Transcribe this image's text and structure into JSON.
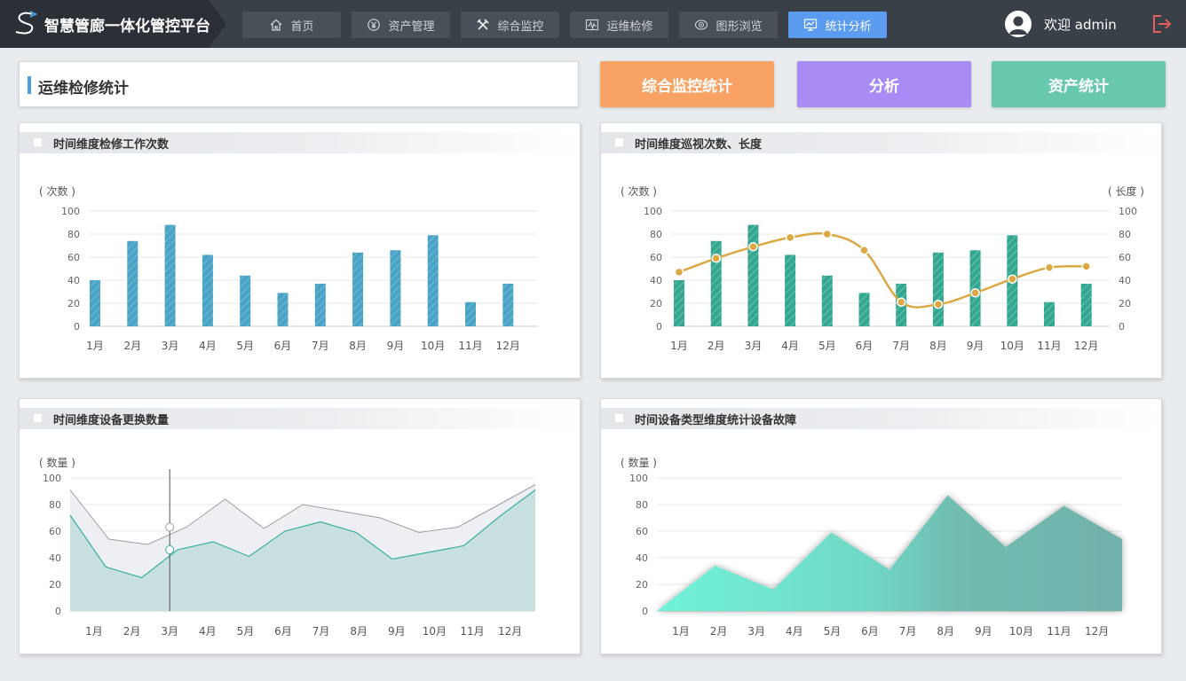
{
  "app": {
    "title": "智慧管廊一体化管控平台"
  },
  "nav": [
    {
      "label": "首页",
      "icon": "home-icon",
      "active": false
    },
    {
      "label": "资产管理",
      "icon": "asset-icon",
      "active": false
    },
    {
      "label": "综合监控",
      "icon": "tools-icon",
      "active": false
    },
    {
      "label": "运维检修",
      "icon": "waveform-icon",
      "active": false
    },
    {
      "label": "图形浏览",
      "icon": "eye-icon",
      "active": false
    },
    {
      "label": "统计分析",
      "icon": "monitor-chart-icon",
      "active": true
    }
  ],
  "user": {
    "welcome": "欢迎 admin"
  },
  "page": {
    "title": "运维检修统计"
  },
  "buttons": {
    "monitor": "综合监控统计",
    "analysis": "分析",
    "asset": "资产统计"
  },
  "colors": {
    "topbar": "#3a4047",
    "active_nav": "#5b9cf0",
    "orange": "#f8a363",
    "purple": "#a98bf6",
    "green": "#67c8ae",
    "bar_blue": "#4aa3c4",
    "bar_teal": "#34a58f",
    "line_gold": "#dba842"
  },
  "chart_data": [
    {
      "id": "c1",
      "type": "bar",
      "title": "时间维度检修工作次数",
      "ylabel": "( 次数 )",
      "ylim": [
        0,
        100
      ],
      "yticks": [
        "100",
        "80",
        "60",
        "40",
        "20",
        "0"
      ],
      "categories": [
        "1月",
        "2月",
        "3月",
        "4月",
        "5月",
        "6月",
        "7月",
        "8月",
        "9月",
        "10月",
        "11月",
        "12月"
      ],
      "series": [
        {
          "values": [
            40,
            74,
            88,
            62,
            44,
            29,
            37,
            64,
            66,
            79,
            21,
            37
          ]
        }
      ]
    },
    {
      "id": "c2",
      "type": "bar",
      "title": "时间维度巡视次数、长度",
      "ylabel": "( 次数 )",
      "ylabel_right": "( 长度 )",
      "ylim": [
        0,
        100
      ],
      "yticks": [
        "100",
        "80",
        "60",
        "40",
        "20",
        "0"
      ],
      "categories": [
        "1月",
        "2月",
        "3月",
        "4月",
        "5月",
        "6月",
        "7月",
        "8月",
        "9月",
        "10月",
        "11月",
        "12月"
      ],
      "series": [
        {
          "type": "bar",
          "values": [
            40,
            74,
            88,
            62,
            44,
            29,
            37,
            64,
            66,
            79,
            21,
            37
          ]
        },
        {
          "type": "line",
          "values": [
            47,
            59,
            69,
            77,
            80,
            66,
            21,
            19,
            29,
            41,
            51,
            52
          ]
        }
      ]
    },
    {
      "id": "c3",
      "type": "area",
      "title": "时间维度设备更换数量",
      "ylabel": "( 数量 )",
      "ylim": [
        0,
        100
      ],
      "yticks": [
        "100",
        "80",
        "60",
        "40",
        "20",
        "0"
      ],
      "categories": [
        "1月",
        "2月",
        "3月",
        "4月",
        "5月",
        "6月",
        "7月",
        "8月",
        "9月",
        "10月",
        "11月",
        "12月"
      ],
      "series": [
        {
          "values": [
            91,
            54,
            50,
            63,
            84,
            62,
            80,
            75,
            70,
            59,
            63,
            79,
            95
          ]
        },
        {
          "values": [
            72,
            33,
            25,
            46,
            52,
            41,
            60,
            67,
            59,
            39,
            44,
            49,
            71,
            91
          ]
        }
      ],
      "hover_category": "3月"
    },
    {
      "id": "c4",
      "type": "area",
      "title": "时间设备类型维度统计设备故障",
      "ylabel": "( 数量 )",
      "ylim": [
        0,
        100
      ],
      "yticks": [
        "100",
        "80",
        "60",
        "40",
        "20",
        "0"
      ],
      "categories": [
        "1月",
        "2月",
        "3月",
        "4月",
        "5月",
        "6月",
        "7月",
        "8月",
        "9月",
        "10月",
        "11月",
        "12月"
      ],
      "series": [
        {
          "values": [
            0,
            34,
            16,
            59,
            31,
            87,
            48,
            79,
            54
          ]
        }
      ]
    }
  ]
}
